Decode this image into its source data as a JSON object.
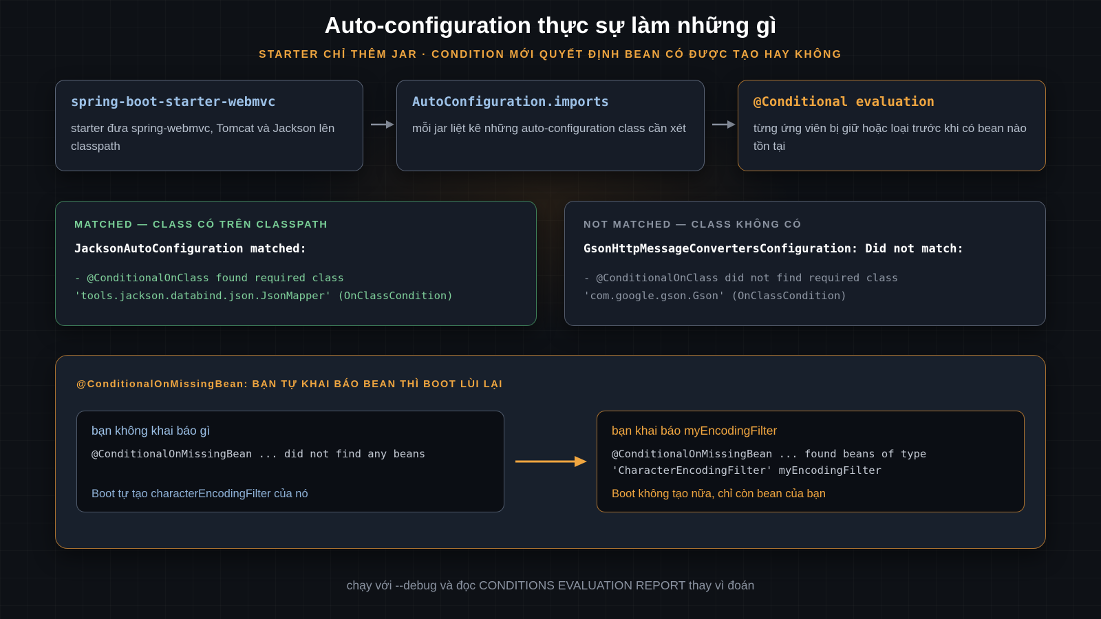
{
  "header": {
    "title": "Auto-configuration thực sự làm những gì",
    "subtitle": "STARTER CHỈ THÊM JAR · CONDITION MỚI QUYẾT ĐỊNH BEAN CÓ ĐƯỢC TẠO HAY KHÔNG"
  },
  "pipeline": {
    "steps": [
      {
        "title": "spring-boot-starter-webmvc",
        "desc": "starter đưa spring-webmvc, Tomcat và Jackson lên classpath"
      },
      {
        "title": "AutoConfiguration.imports",
        "desc": "mỗi jar liệt kê những auto-configuration class cần xét"
      },
      {
        "title": "@Conditional evaluation",
        "desc": "từng ứng viên bị giữ hoặc loại trước khi có bean nào tồn tại"
      }
    ]
  },
  "matched": {
    "label": "MATCHED — CLASS CÓ TRÊN CLASSPATH",
    "headline": "JacksonAutoConfiguration matched:",
    "line1": "- @ConditionalOnClass found required class",
    "line2": "'tools.jackson.databind.json.JsonMapper' (OnClassCondition)"
  },
  "not_matched": {
    "label": "NOT MATCHED — CLASS KHÔNG CÓ",
    "headline": "GsonHttpMessageConvertersConfiguration: Did not match:",
    "line1": "- @ConditionalOnClass did not find required class",
    "line2": "'com.google.gson.Gson' (OnClassCondition)"
  },
  "missing_bean": {
    "title": "@ConditionalOnMissingBean: BẠN TỰ KHAI BÁO BEAN THÌ BOOT LÙI LẠI",
    "left": {
      "title": "bạn không khai báo gì",
      "code": "@ConditionalOnMissingBean ... did not find any beans",
      "result": "Boot tự tạo characterEncodingFilter của nó"
    },
    "right": {
      "title": "bạn khai báo myEncodingFilter",
      "code": "@ConditionalOnMissingBean ... found beans of type\n'CharacterEncodingFilter' myEncodingFilter",
      "result": "Boot không tạo nữa, chỉ còn bean của bạn"
    }
  },
  "footer": {
    "text": "chạy với --debug và đọc CONDITIONS EVALUATION REPORT thay vì đoán"
  },
  "colors": {
    "accent_orange": "#f0a640",
    "accent_green": "#79cf97",
    "accent_blue": "#9cc0e6",
    "background": "#0e1116"
  }
}
